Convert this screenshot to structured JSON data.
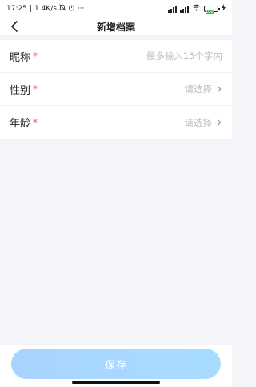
{
  "status_bar": {
    "time": "17:25",
    "speed": "1.4K/s",
    "more": "···",
    "battery": "100"
  },
  "header": {
    "title": "新增档案"
  },
  "form": {
    "rows": [
      {
        "label": "昵称",
        "required_mark": "*",
        "value": "最多输入15个字内"
      },
      {
        "label": "性别",
        "required_mark": "*",
        "value": "请选择"
      },
      {
        "label": "年龄",
        "required_mark": "*",
        "value": "请选择"
      }
    ]
  },
  "footer": {
    "save_label": "保存"
  },
  "colors": {
    "required": "#ff4d4f",
    "placeholder": "#b8bcc4",
    "button": "#a9d4ff",
    "background": "#f3f5f9"
  }
}
